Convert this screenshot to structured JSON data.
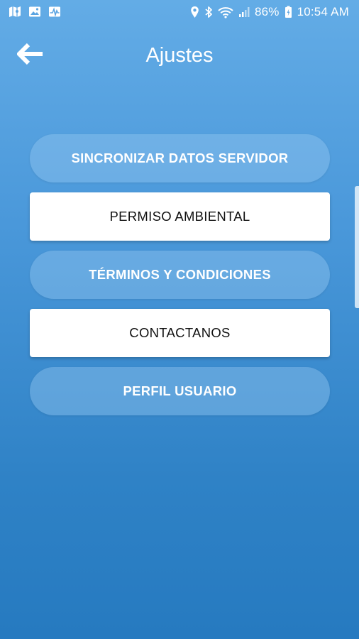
{
  "status_bar": {
    "battery": "86%",
    "time": "10:54 AM",
    "notification_icons": [
      "map-icon",
      "image-icon",
      "activity-icon"
    ],
    "system_icons": [
      "location-icon",
      "bluetooth-icon",
      "wifi-icon",
      "signal-icon",
      "battery-icon"
    ]
  },
  "header": {
    "title": "Ajustes",
    "back_icon": "arrow-left-icon"
  },
  "menu": {
    "items": [
      {
        "label": "SINCRONIZAR DATOS SERVIDOR",
        "style": "pill"
      },
      {
        "label": "PERMISO AMBIENTAL",
        "style": "white"
      },
      {
        "label": "TÉRMINOS Y CONDICIONES",
        "style": "pill"
      },
      {
        "label": "CONTACTANOS",
        "style": "white"
      },
      {
        "label": "PERFIL USUARIO",
        "style": "pill"
      }
    ]
  },
  "colors": {
    "background_top": "#63ace6",
    "background_bottom": "#267ac0",
    "pill_button": "#8fc4ee",
    "white_button": "#ffffff",
    "text_light": "#ffffff",
    "text_dark": "#111111"
  }
}
